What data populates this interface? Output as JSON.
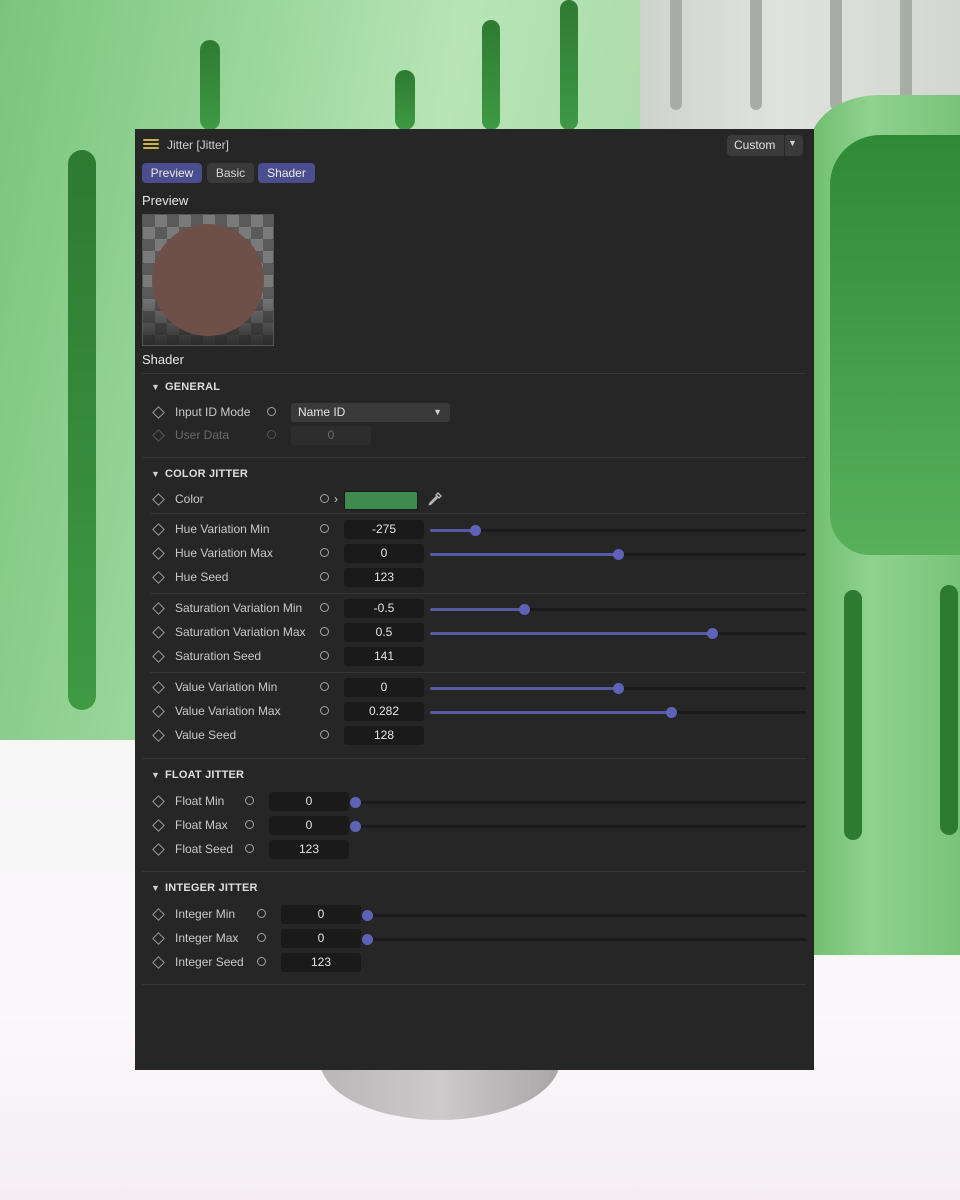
{
  "window": {
    "title": "Jitter [Jitter]",
    "layout_preset": "Custom"
  },
  "tabs": [
    {
      "label": "Preview",
      "active": true
    },
    {
      "label": "Basic",
      "active": false
    },
    {
      "label": "Shader",
      "active": true
    }
  ],
  "preview": {
    "heading": "Preview",
    "sphere_color": "#6e5049"
  },
  "shader": {
    "heading": "Shader"
  },
  "general": {
    "title": "GENERAL",
    "input_id_mode": {
      "label": "Input ID Mode",
      "value": "Name ID"
    },
    "user_data": {
      "label": "User Data",
      "value": "0"
    }
  },
  "color_jitter": {
    "title": "COLOR JITTER",
    "color": {
      "label": "Color",
      "value": "#3f8a4f"
    },
    "hue_min": {
      "label": "Hue Variation Min",
      "value": "-275",
      "slider": 0.12
    },
    "hue_max": {
      "label": "Hue Variation Max",
      "value": "0",
      "slider": 0.5
    },
    "hue_seed": {
      "label": "Hue Seed",
      "value": "123"
    },
    "sat_min": {
      "label": "Saturation Variation Min",
      "value": "-0.5",
      "slider": 0.25
    },
    "sat_max": {
      "label": "Saturation Variation Max",
      "value": "0.5",
      "slider": 0.75
    },
    "sat_seed": {
      "label": "Saturation Seed",
      "value": "141"
    },
    "val_min": {
      "label": "Value Variation Min",
      "value": "0",
      "slider": 0.5
    },
    "val_max": {
      "label": "Value Variation Max",
      "value": "0.282",
      "slider": 0.64
    },
    "val_seed": {
      "label": "Value Seed",
      "value": "128"
    }
  },
  "float_jitter": {
    "title": "FLOAT JITTER",
    "min": {
      "label": "Float Min",
      "value": "0",
      "slider": 0.0
    },
    "max": {
      "label": "Float Max",
      "value": "0",
      "slider": 0.0
    },
    "seed": {
      "label": "Float Seed",
      "value": "123"
    }
  },
  "integer_jitter": {
    "title": "INTEGER JITTER",
    "min": {
      "label": "Integer Min",
      "value": "0",
      "slider": 0.0
    },
    "max": {
      "label": "Integer Max",
      "value": "0",
      "slider": 0.0
    },
    "seed": {
      "label": "Integer Seed",
      "value": "123"
    }
  },
  "colors": {
    "panel": "#262626",
    "accent": "#4a4e8e",
    "slider": "#5f63b8"
  }
}
